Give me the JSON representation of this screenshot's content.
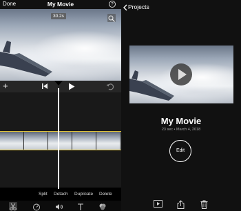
{
  "editor": {
    "done_label": "Done",
    "title": "My Movie",
    "help_label": "?",
    "duration_badge": "30.2s",
    "actions": [
      "Split",
      "Detach",
      "Duplicate",
      "Delete"
    ],
    "tools": [
      "scissors-icon",
      "speed-icon",
      "volume-icon",
      "text-icon",
      "filters-icon"
    ]
  },
  "project": {
    "back_label": "Projects",
    "title": "My Movie",
    "meta": "23 sec • March 4, 2018",
    "edit_label": "Edit",
    "bottom_icons": [
      "play-icon",
      "share-icon",
      "trash-icon"
    ]
  },
  "colors": {
    "clip_border": "#e5c633",
    "background": "#000000",
    "panel": "#111111"
  }
}
